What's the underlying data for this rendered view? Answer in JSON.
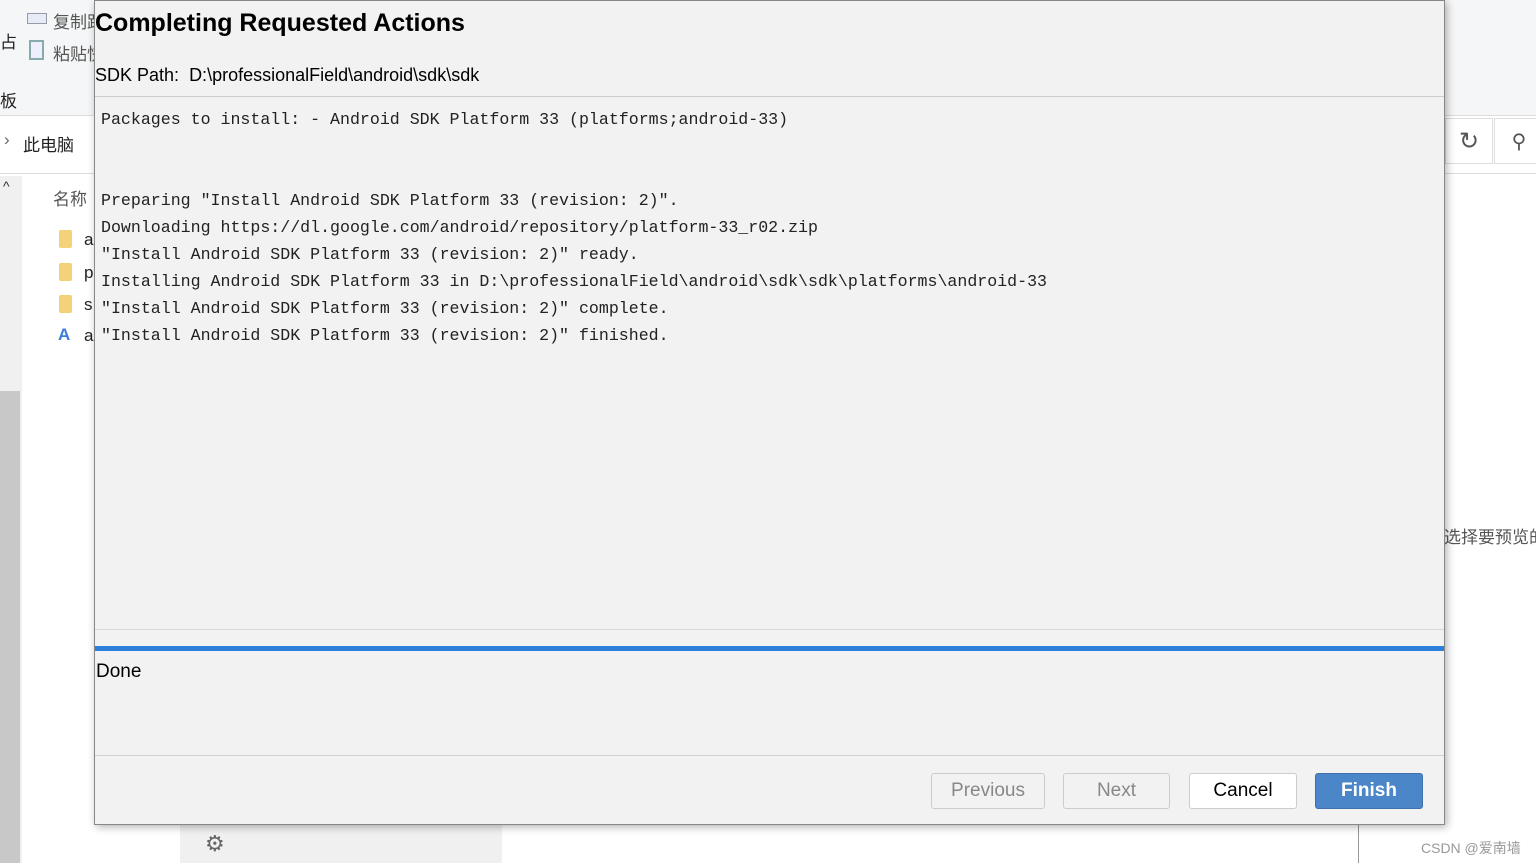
{
  "background": {
    "ribbon": {
      "copy": "复制路",
      "paste": "粘贴快",
      "clipboard": "板",
      "left_char": "占"
    },
    "breadcrumb": "此电脑",
    "column_header": "名称",
    "files": [
      "a",
      "p",
      "s",
      "a"
    ],
    "preview_text": "选择要预览的",
    "watermark": "CSDN @爱南墙"
  },
  "dialog": {
    "title": "Completing Requested Actions",
    "sdk_path_label": "SDK Path:",
    "sdk_path": "D:\\professionalField\\android\\sdk\\sdk",
    "log": "Packages to install: - Android SDK Platform 33 (platforms;android-33)\n\n\nPreparing \"Install Android SDK Platform 33 (revision: 2)\".\nDownloading https://dl.google.com/android/repository/platform-33_r02.zip\n\"Install Android SDK Platform 33 (revision: 2)\" ready.\nInstalling Android SDK Platform 33 in D:\\professionalField\\android\\sdk\\sdk\\platforms\\android-33\n\"Install Android SDK Platform 33 (revision: 2)\" complete.\n\"Install Android SDK Platform 33 (revision: 2)\" finished.",
    "progress_percent": 100,
    "status": "Done",
    "buttons": {
      "previous": "Previous",
      "next": "Next",
      "cancel": "Cancel",
      "finish": "Finish"
    },
    "accent_color": "#4a86c8"
  }
}
